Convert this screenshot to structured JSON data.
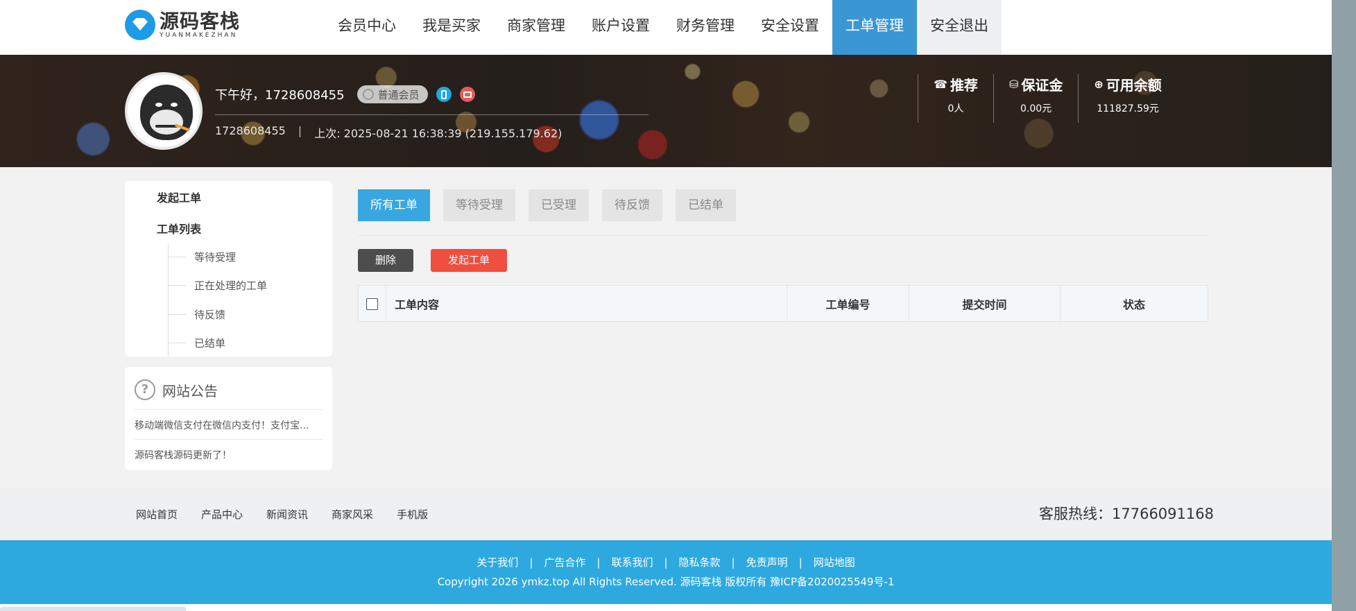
{
  "logo": {
    "cn": "源码客栈",
    "en": "YUANMAKEZHAN"
  },
  "nav": [
    {
      "label": "会员中心"
    },
    {
      "label": "我是买家"
    },
    {
      "label": "商家管理"
    },
    {
      "label": "账户设置"
    },
    {
      "label": "财务管理"
    },
    {
      "label": "安全设置"
    },
    {
      "label": "工单管理",
      "active": true
    },
    {
      "label": "安全退出"
    }
  ],
  "profile": {
    "greeting": "下午好，1728608455",
    "badge": "普通会员",
    "username": "1728608455",
    "separator": "|",
    "last_login": "上次: 2025-08-21 16:38:39 (219.155.179.62)"
  },
  "stats": [
    {
      "title": "推荐",
      "value": "0人",
      "icon": "phone-icon"
    },
    {
      "title": "保证金",
      "value": "0.00元",
      "icon": "database-icon"
    },
    {
      "title": "可用余额",
      "value": "111827.59元",
      "icon": "coin-icon"
    }
  ],
  "sidebar": {
    "items": [
      {
        "label": "发起工单"
      },
      {
        "label": "工单列表"
      }
    ],
    "subitems": [
      {
        "label": "等待受理"
      },
      {
        "label": "正在处理的工单"
      },
      {
        "label": "待反馈"
      },
      {
        "label": "已结单"
      }
    ]
  },
  "notice": {
    "title": "网站公告",
    "items": [
      {
        "text": "移动端微信支付在微信内支付！支付宝..."
      },
      {
        "text": "源码客栈源码更新了！"
      }
    ]
  },
  "tabs": [
    {
      "label": "所有工单",
      "active": true
    },
    {
      "label": "等待受理"
    },
    {
      "label": "已受理"
    },
    {
      "label": "待反馈"
    },
    {
      "label": "已结单"
    }
  ],
  "buttons": {
    "delete": "删除",
    "new_ticket": "发起工单"
  },
  "table": {
    "columns": [
      "工单内容",
      "工单编号",
      "提交时间",
      "状态"
    ]
  },
  "footer": {
    "links": [
      "网站首页",
      "产品中心",
      "新闻资讯",
      "商家风采",
      "手机版"
    ],
    "hotline": "客服热线：17766091168",
    "blue_links": [
      "关于我们",
      "广告合作",
      "联系我们",
      "隐私条款",
      "免责声明",
      "网站地图"
    ],
    "blue_sep": "|",
    "copyright": "Copyright 2026 ymkz.top All Rights Reserved. 源码客栈   版权所有   豫ICP备2020025549号-1"
  },
  "colors": {
    "nav_active": "#3b97d3",
    "tab_active": "#3aa6e0",
    "delete_button": "#4d4d4d",
    "new_button": "#f04e3e",
    "footer_blue": "#2ea9df"
  }
}
